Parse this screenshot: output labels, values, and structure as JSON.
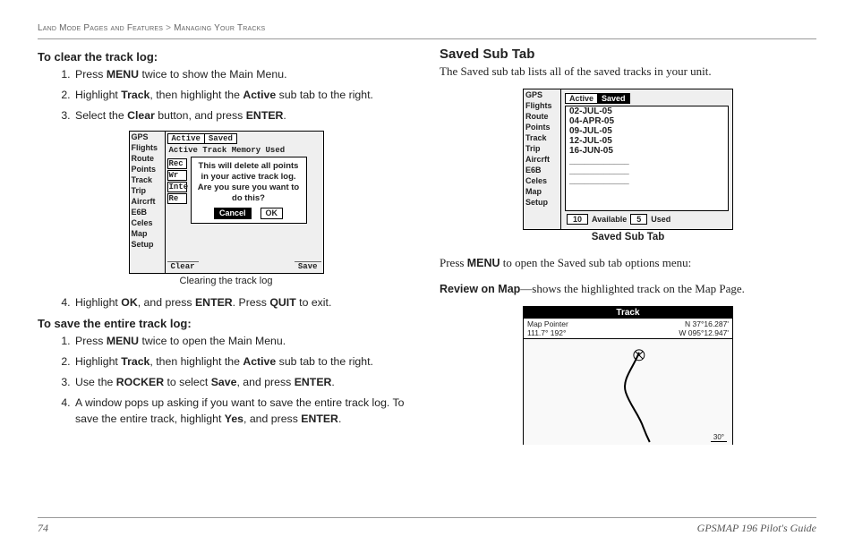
{
  "breadcrumb": {
    "a": "Land Mode Pages and Features",
    "sep": ">",
    "b": "Managing Your Tracks"
  },
  "left": {
    "h1": "To clear the track log:",
    "steps1": [
      "Press <b>MENU</b> twice to show the Main Menu.",
      "Highlight <b>Track</b>, then highlight the <b>Active</b> sub tab to the right.",
      "Select the <b>Clear</b> button, and press <b>ENTER</b>."
    ],
    "caption1": "Clearing the track log",
    "step4": "Highlight <b>OK</b>, and press <b>ENTER</b>. Press <b>QUIT</b> to exit.",
    "h2": "To save the entire track log:",
    "steps2": [
      "Press <b>MENU</b> twice to open the Main Menu.",
      "Highlight <b>Track</b>, then highlight the <b>Active</b> sub tab to the right.",
      "Use the <b>ROCKER</b> to select <b>Save</b>, and press <b>ENTER</b>.",
      "A window pops up asking if you want to save the entire track log. To save the entire track, highlight <b>Yes</b>, and press <b>ENTER</b>."
    ]
  },
  "right": {
    "title": "Saved Sub Tab",
    "intro": "The Saved sub tab lists all of the saved tracks in your unit.",
    "caption2": "Saved Sub Tab",
    "p2": "Press <b>MENU</b> to open the Saved sub tab options menu:",
    "p3": "<b>Review on Map</b>—shows the highlighted track on the Map Page."
  },
  "dev_side": [
    "GPS",
    "Flights",
    "Route",
    "Points",
    "Track",
    "Trip",
    "Aircrft",
    "E6B",
    "Celes",
    "Map",
    "Setup"
  ],
  "dev1": {
    "tabs": [
      "Active",
      "Saved"
    ],
    "mem": "Active Track Memory Used",
    "mini": [
      "Rec",
      "Wr",
      "Inte",
      "Re"
    ],
    "dlg1": "This will delete all points in your active track log.  Are you sure you want to do this?",
    "btn_cancel": "Cancel",
    "btn_ok": "OK",
    "clear": "Clear",
    "save": "Save"
  },
  "dev2": {
    "tabs": [
      "Active",
      "Saved"
    ],
    "items": [
      "02-JUL-05",
      "04-APR-05",
      "09-JUL-05",
      "12-JUL-05",
      "16-JUN-05",
      "____________",
      "____________",
      "____________"
    ],
    "avail_n": "10",
    "avail": "Available",
    "used_n": "5",
    "used": "Used"
  },
  "dev3": {
    "title": "Track",
    "left1": "Map Pointer",
    "left2": "111.7°  192°",
    "r1": "N   37°16.287'",
    "r2": "W  095°12.947'",
    "scale": "30°"
  },
  "footer": {
    "page": "74",
    "book": "GPSMAP 196 Pilot's Guide"
  }
}
